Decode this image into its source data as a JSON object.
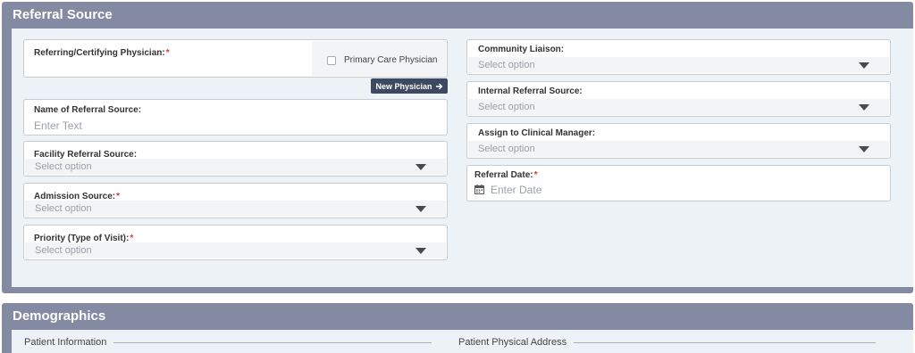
{
  "referral": {
    "title": "Referral Source",
    "physician_label": "Referring/Certifying Physician:",
    "primary_care_label": "Primary Care Physician",
    "new_physician_label": "New Physician",
    "name_label": "Name of Referral Source:",
    "name_placeholder": "Enter Text",
    "facility_label": "Facility Referral Source:",
    "facility_value": "Select option",
    "admission_label": "Admission Source:",
    "admission_value": "Select option",
    "priority_label": "Priority (Type of Visit):",
    "priority_value": "Select option",
    "liaison_label": "Community Liaison:",
    "liaison_value": "Select option",
    "internal_label": "Internal Referral Source:",
    "internal_value": "Select option",
    "manager_label": "Assign to Clinical Manager:",
    "manager_value": "Select option",
    "date_label": "Referral Date:",
    "date_placeholder": "Enter Date",
    "required_mark": "*"
  },
  "demographics": {
    "title": "Demographics",
    "patient_info_label": "Patient Information",
    "address_label": "Patient Physical Address"
  },
  "colors": {
    "header_bg": "#838aa2",
    "body_bg": "#edf2f6",
    "button_bg": "#3d4961",
    "required": "#e03535"
  },
  "icons": [
    "caret-down-icon",
    "arrow-right-icon",
    "calendar-icon",
    "checkbox-icon"
  ]
}
